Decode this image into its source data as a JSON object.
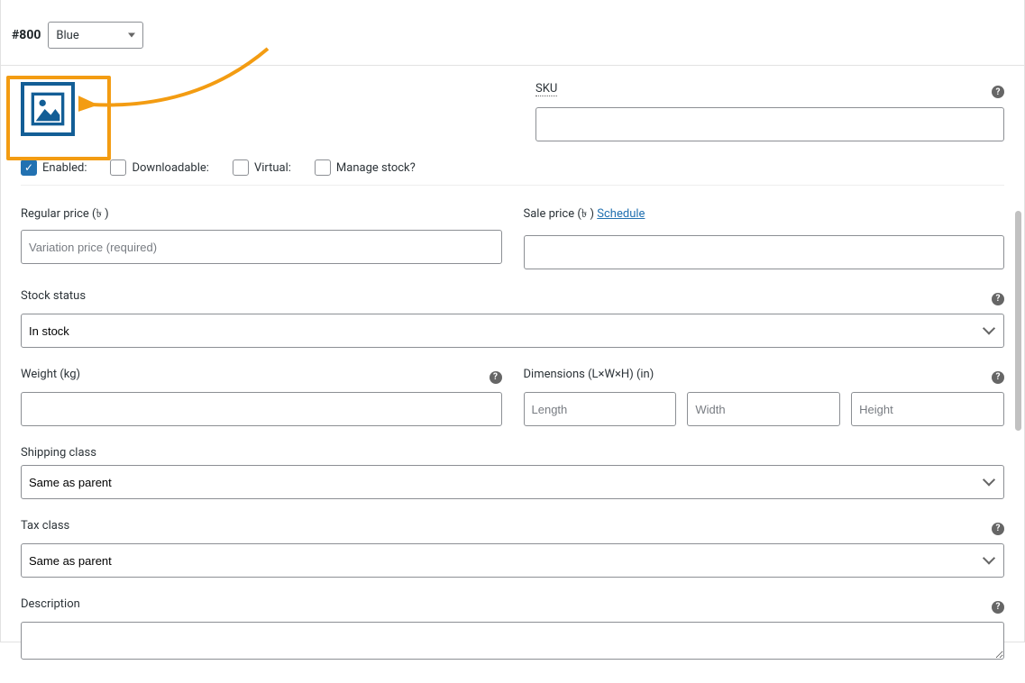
{
  "header": {
    "variation_id": "#800",
    "color_value": "Blue"
  },
  "checkboxes": {
    "enabled": {
      "label": "Enabled:",
      "checked": true
    },
    "downloadable": {
      "label": "Downloadable:",
      "checked": false
    },
    "virtual": {
      "label": "Virtual:",
      "checked": false
    },
    "manage_stock": {
      "label": "Manage stock?",
      "checked": false
    }
  },
  "sku": {
    "label": "SKU",
    "value": ""
  },
  "regular_price": {
    "label": "Regular price (৳ )",
    "placeholder": "Variation price (required)",
    "value": ""
  },
  "sale_price": {
    "label": "Sale price (৳ )",
    "schedule": "Schedule",
    "value": ""
  },
  "stock_status": {
    "label": "Stock status",
    "value": "In stock"
  },
  "weight": {
    "label": "Weight (kg)",
    "value": ""
  },
  "dimensions": {
    "label": "Dimensions (L×W×H) (in)",
    "length_placeholder": "Length",
    "width_placeholder": "Width",
    "height_placeholder": "Height",
    "length": "",
    "width": "",
    "height": ""
  },
  "shipping_class": {
    "label": "Shipping class",
    "value": "Same as parent"
  },
  "tax_class": {
    "label": "Tax class",
    "value": "Same as parent"
  },
  "description": {
    "label": "Description",
    "value": ""
  },
  "help_glyph": "?"
}
